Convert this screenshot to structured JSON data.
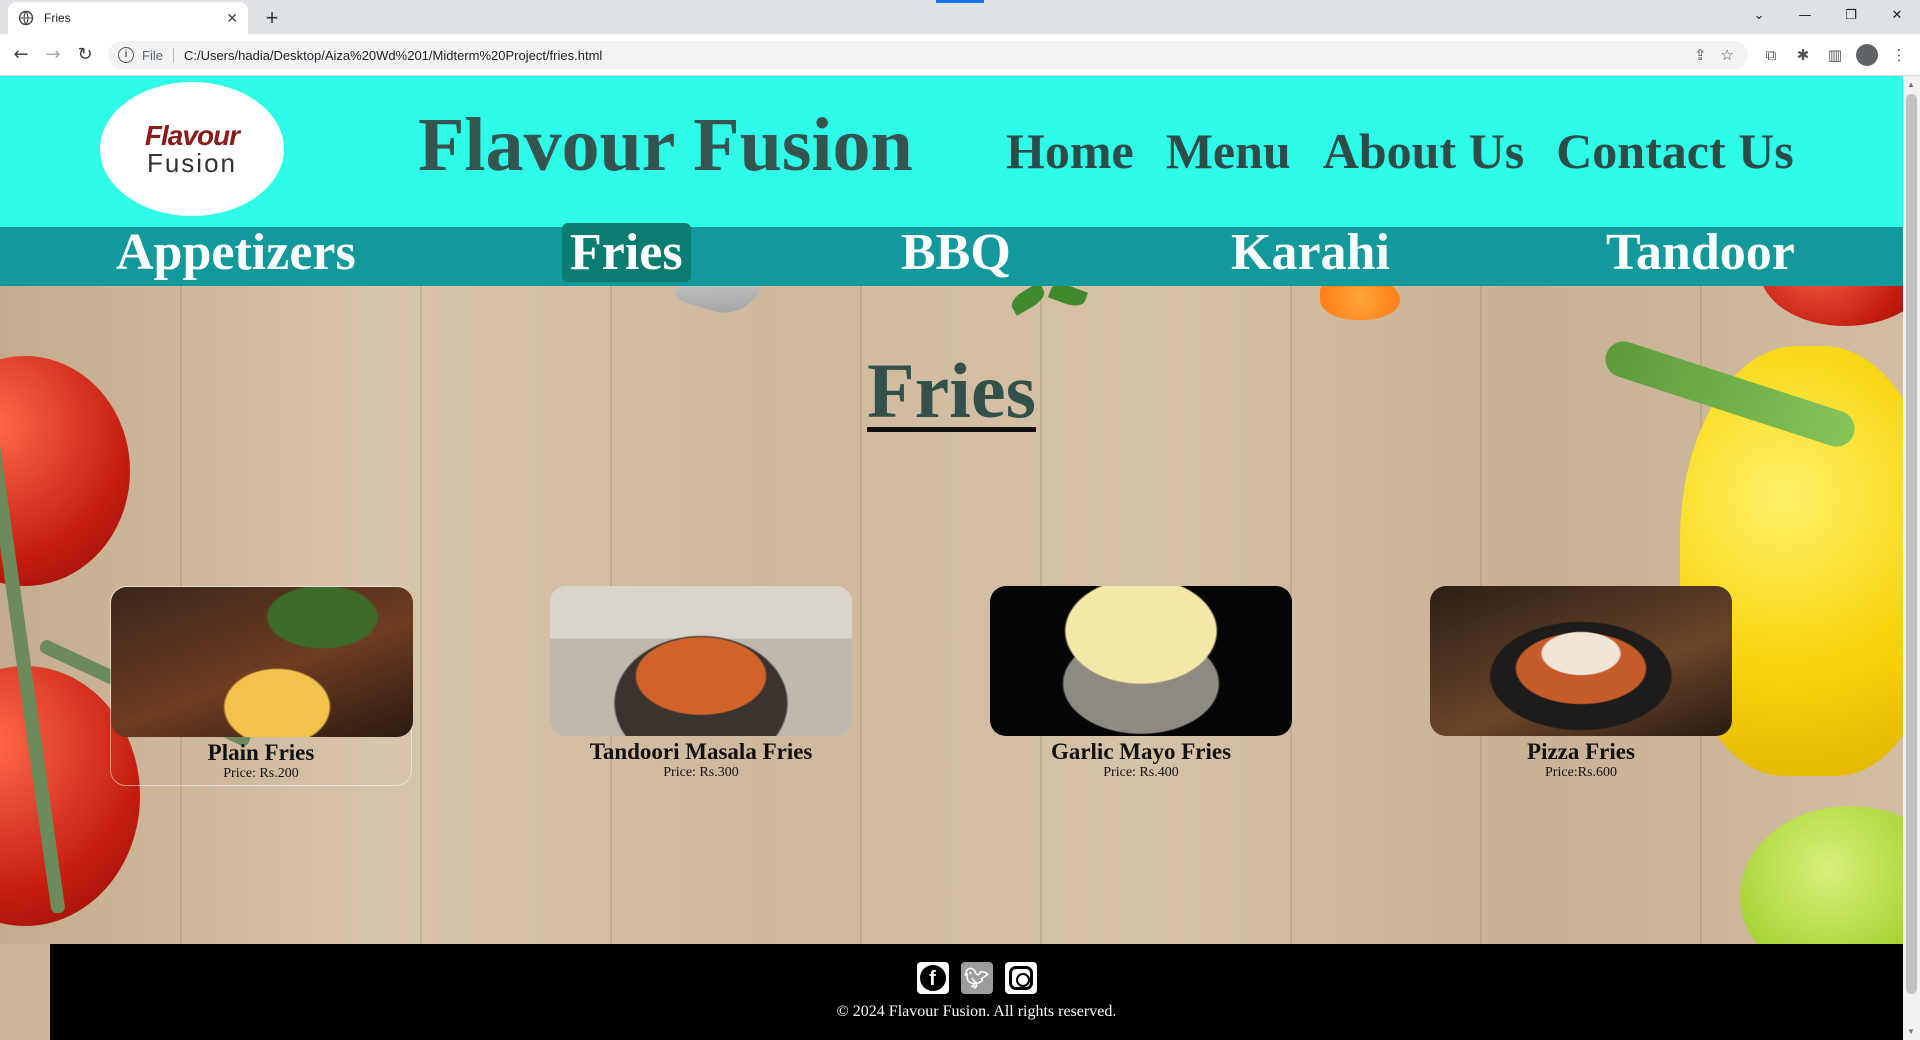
{
  "browser": {
    "tab_title": "Fries",
    "new_tab_label": "+",
    "url_scheme": "File",
    "url": "C:/Users/hadia/Desktop/Aiza%20Wd%201/Midterm%20Project/fries.html"
  },
  "site": {
    "logo_line1": "Flavour",
    "logo_line2": "Fusion",
    "title": "Flavour Fusion",
    "nav": [
      "Home",
      "Menu",
      "About Us",
      "Contact Us"
    ]
  },
  "categories": {
    "items": [
      "Appetizers",
      "Fries",
      "BBQ",
      "Karahi",
      "Tandoor"
    ],
    "active": "Fries"
  },
  "page": {
    "heading": "Fries",
    "items": [
      {
        "name": "Plain Fries",
        "price": "Price: Rs.200"
      },
      {
        "name": "Tandoori Masala Fries",
        "price": "Price: Rs.300"
      },
      {
        "name": "Garlic Mayo Fries",
        "price": "Price: Rs.400"
      },
      {
        "name": "Pizza Fries",
        "price": "Price:Rs.600"
      }
    ]
  },
  "footer": {
    "social_icons": [
      "facebook-icon",
      "twitter-icon",
      "instagram-icon"
    ],
    "copyright": "© 2024 Flavour Fusion. All rights reserved."
  },
  "colors": {
    "header_bg": "#2ffbe9",
    "category_bar_bg": "#11999b",
    "active_category_bg": "#0b7d70",
    "title_color": "#355450",
    "footer_bg": "#000000"
  }
}
